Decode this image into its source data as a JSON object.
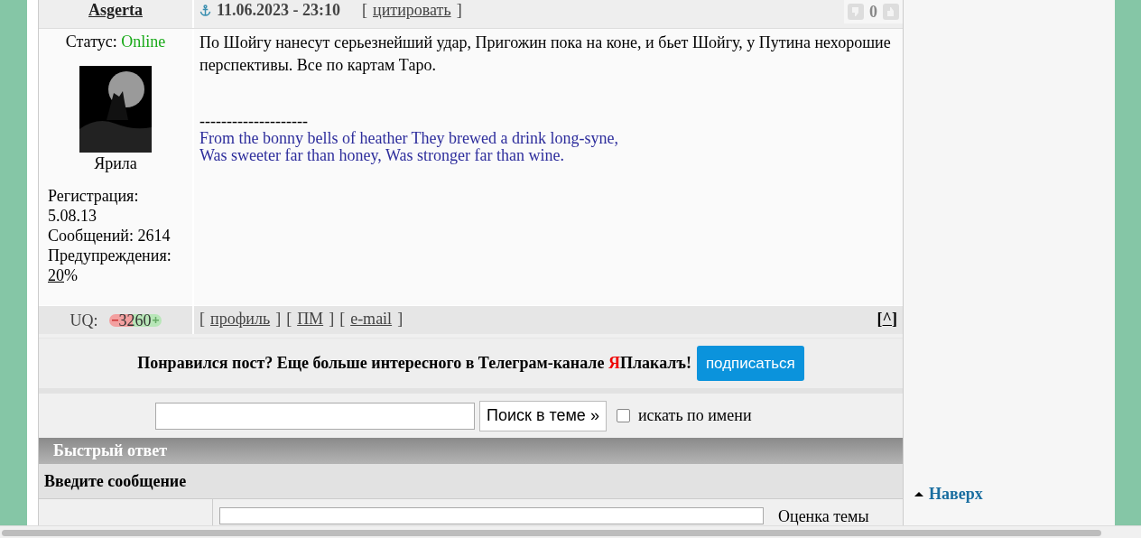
{
  "post": {
    "author": "Asgerta",
    "date": "11.06.2023 - 23:10",
    "brackets": [
      "[",
      "]"
    ],
    "quote_link": "цитировать",
    "rating": "0",
    "status_label": "Статус:",
    "status": "Online",
    "avatar_name": "Ярила",
    "registration_label": "Регистрация:",
    "registration": "5.08.13",
    "messages": "Сообщений: 2614",
    "warnings_label": "Предупреждения:",
    "warnings_value": "20",
    "warnings_unit": "%",
    "body": "По Шойгу нанесут серьезнейший удар, Пригожин пока на коне, и бьет Шойгу, у Путина нехорошие перспективы. Все по картам Таро.",
    "signature_rule": "--------------------",
    "signature": [
      "From the bonny bells of heather They brewed a drink long-syne,",
      "Was sweeter far than honey, Was stronger far than wine."
    ]
  },
  "footer": {
    "uq_label": "UQ:",
    "uq": "3260",
    "links": [
      "профиль",
      "ПМ",
      "e-mail"
    ],
    "top_link": "^"
  },
  "promo": {
    "text": "Понравился пост? Еще больше интересного в Телеграм-канале ",
    "brand_first": "Я",
    "brand_rest": "Плакалъ!",
    "button": "подписаться"
  },
  "search": {
    "button": "Поиск в теме »",
    "checkbox_label": "искать по имени",
    "checked": false
  },
  "quick_reply": {
    "title": "Быстрый ответ",
    "prompt": "Введите сообщение",
    "rating_label": "Оценка темы"
  },
  "to_top": "Наверх"
}
